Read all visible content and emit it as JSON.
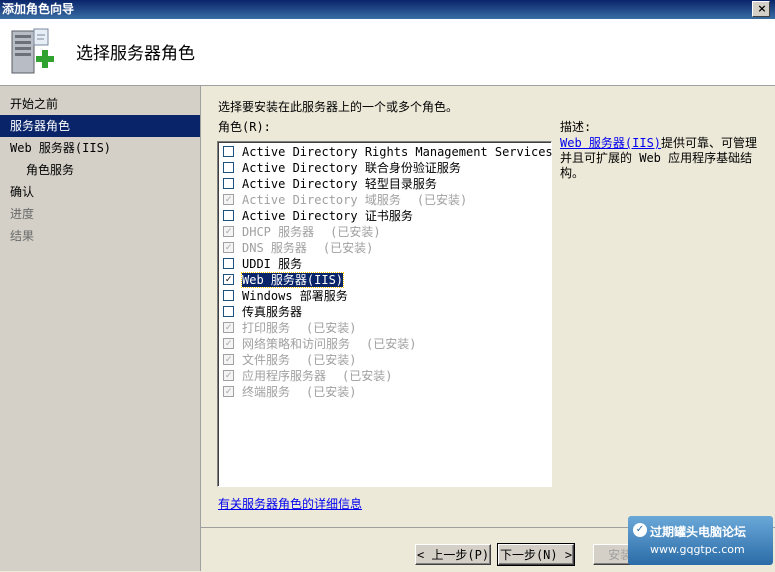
{
  "window": {
    "title": "添加角色向导",
    "close_glyph": "×"
  },
  "header": {
    "title": "选择服务器角色",
    "icon": "server-add-icon"
  },
  "nav": {
    "items": [
      {
        "label": "开始之前",
        "state": "normal",
        "level": 0
      },
      {
        "label": "服务器角色",
        "state": "selected",
        "level": 0
      },
      {
        "label": "Web 服务器(IIS)",
        "state": "normal",
        "level": 0
      },
      {
        "label": "角色服务",
        "state": "normal",
        "level": 1
      },
      {
        "label": "确认",
        "state": "normal",
        "level": 0
      },
      {
        "label": "进度",
        "state": "disabled",
        "level": 0
      },
      {
        "label": "结果",
        "state": "disabled",
        "level": 0
      }
    ]
  },
  "main": {
    "instruction": "选择要安装在此服务器上的一个或多个角色。",
    "roles_label": "角色(R):",
    "roles": [
      {
        "name": "Active Directory Rights Management Services",
        "checked": false,
        "disabled": false,
        "status": ""
      },
      {
        "name": "Active Directory 联合身份验证服务",
        "checked": false,
        "disabled": false,
        "status": ""
      },
      {
        "name": "Active Directory 轻型目录服务",
        "checked": false,
        "disabled": false,
        "status": ""
      },
      {
        "name": "Active Directory 域服务",
        "checked": true,
        "disabled": true,
        "status": "(已安装)"
      },
      {
        "name": "Active Directory 证书服务",
        "checked": false,
        "disabled": false,
        "status": ""
      },
      {
        "name": "DHCP 服务器",
        "checked": true,
        "disabled": true,
        "status": "(已安装)"
      },
      {
        "name": "DNS 服务器",
        "checked": true,
        "disabled": true,
        "status": "(已安装)"
      },
      {
        "name": "UDDI 服务",
        "checked": false,
        "disabled": false,
        "status": ""
      },
      {
        "name": "Web 服务器(IIS)",
        "checked": true,
        "disabled": false,
        "status": "",
        "highlight": true
      },
      {
        "name": "Windows 部署服务",
        "checked": false,
        "disabled": false,
        "status": ""
      },
      {
        "name": "传真服务器",
        "checked": false,
        "disabled": false,
        "status": ""
      },
      {
        "name": "打印服务",
        "checked": true,
        "disabled": true,
        "status": "(已安装)"
      },
      {
        "name": "网络策略和访问服务",
        "checked": true,
        "disabled": true,
        "status": "(已安装)"
      },
      {
        "name": "文件服务",
        "checked": true,
        "disabled": true,
        "status": "(已安装)"
      },
      {
        "name": "应用程序服务器",
        "checked": true,
        "disabled": true,
        "status": "(已安装)"
      },
      {
        "name": "终端服务",
        "checked": true,
        "disabled": true,
        "status": "(已安装)"
      }
    ],
    "more_info_link": "有关服务器角色的详细信息",
    "description": {
      "label": "描述:",
      "link": "Web 服务器(IIS)",
      "text": "提供可靠、可管理并且可扩展的 Web 应用程序基础结构。"
    }
  },
  "footer": {
    "back": "< 上一步(P)",
    "next": "下一步(N) >",
    "install": "安装(I)"
  },
  "watermark": {
    "line1": "过期罐头电脑论坛",
    "line2": "www.gqgtpc.com"
  }
}
